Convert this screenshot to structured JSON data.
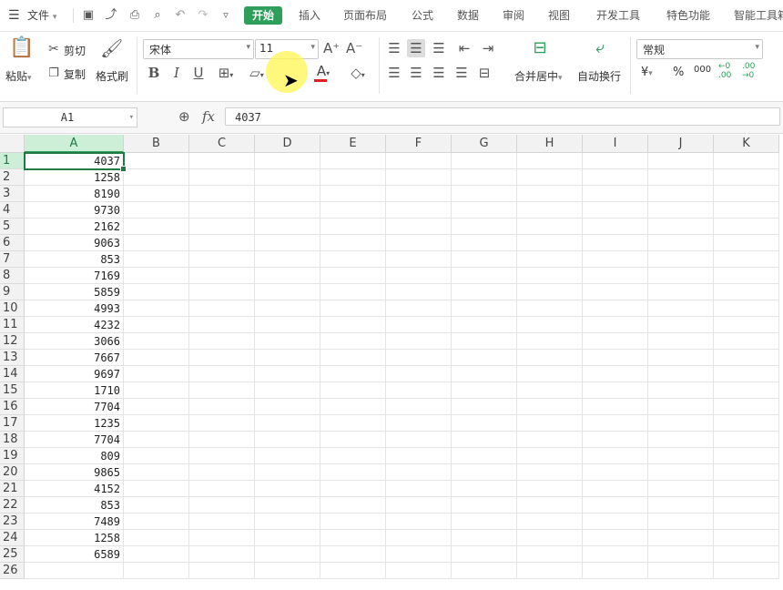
{
  "menubar": {
    "file_label": "文件",
    "tabs": [
      {
        "label": "开始",
        "active": true
      },
      {
        "label": "插入"
      },
      {
        "label": "页面布局"
      },
      {
        "label": "公式"
      },
      {
        "label": "数据"
      },
      {
        "label": "审阅"
      },
      {
        "label": "视图"
      },
      {
        "label": "开发工具"
      },
      {
        "label": "特色功能"
      },
      {
        "label": "智能工具箱"
      }
    ]
  },
  "ribbon": {
    "paste_label": "粘贴",
    "cut_label": "剪切",
    "copy_label": "复制",
    "format_painter_label": "格式刷",
    "font_name": "宋体",
    "font_size": "11",
    "merge_center_label": "合并居中",
    "wrap_text_label": "自动换行",
    "number_format": "常规",
    "currency_symbol": "¥",
    "percent_symbol": "%",
    "thousands_symbol": "000"
  },
  "formula_bar": {
    "cell_ref": "A1",
    "fx_label": "fx",
    "value": "4037"
  },
  "sheet": {
    "columns": [
      "A",
      "B",
      "C",
      "D",
      "E",
      "F",
      "G",
      "H",
      "I",
      "J",
      "K"
    ],
    "selected_column": "A",
    "row_labels": [
      "1",
      "2",
      "3",
      "4",
      "5",
      "6",
      "7",
      "8",
      "9",
      "10",
      "11",
      "12",
      "13",
      "14",
      "15",
      "16",
      "17",
      "18",
      "19",
      "20",
      "21",
      "22",
      "23",
      "24",
      "25",
      "26"
    ],
    "column_a_values": [
      "4037",
      "1258",
      "8190",
      "9730",
      "2162",
      "9063",
      "853",
      "7169",
      "5859",
      "4993",
      "4232",
      "3066",
      "7667",
      "9697",
      "1710",
      "7704",
      "1235",
      "7704",
      "809",
      "9865",
      "4152",
      "853",
      "7489",
      "1258",
      "6589",
      ""
    ]
  },
  "colors": {
    "accent": "#2e9e5b",
    "selection": "#1f7a44",
    "header_selected": "#cdeed7",
    "cursor_highlight": "#fff550",
    "font_color_bar": "#e02020"
  }
}
